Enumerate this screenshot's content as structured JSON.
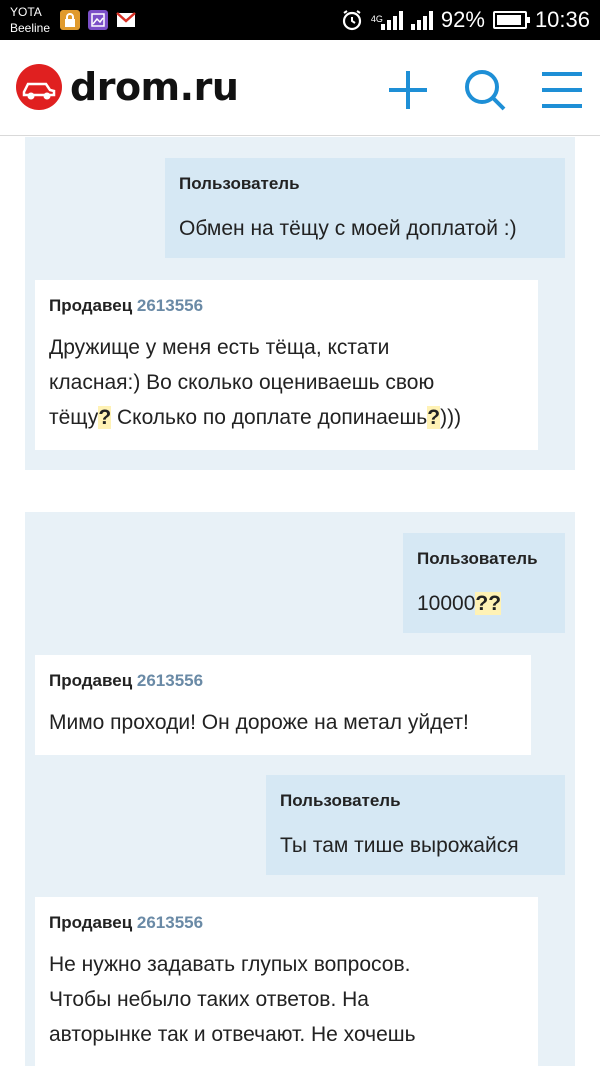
{
  "status_bar": {
    "carrier_1": "YOTA",
    "carrier_2": "Beeline",
    "network": "4G",
    "battery": "92%",
    "battery_level": 0.92,
    "time": "10:36"
  },
  "header": {
    "logo_text": "drom.ru",
    "icons": [
      "plus-icon",
      "search-icon",
      "menu-icon"
    ]
  },
  "conversation_1": {
    "user_author": "Пользователь",
    "user_message": "Обмен на тёщу с моей доплатой :)",
    "seller_author": "Продавец",
    "seller_id": "2613556",
    "seller_line_1": "Дружище у меня есть тёща, кстати",
    "seller_line_2": "класная:) Во сколько оцениваешь свою",
    "seller_line_3a": "тёщу",
    "seller_line_3q1": "?",
    "seller_line_3b": " Сколько по доплате допинаешь",
    "seller_line_3q2": "?",
    "seller_line_3c": ")))"
  },
  "conversation_2": {
    "user1_author": "Пользователь",
    "user1_message_a": "10000",
    "user1_message_q": "??",
    "seller1_author": "Продавец",
    "seller1_id": "2613556",
    "seller1_message": "Мимо проходи! Он дороже на метал уйдет!",
    "user2_author": "Пользователь",
    "user2_message": "Ты там тише вырожайся",
    "seller2_author": "Продавец",
    "seller2_id": "2613556",
    "seller2_line_1": "Не нужно задавать глупых вопросов.",
    "seller2_line_2": "Чтобы небыло таких ответов. На",
    "seller2_line_3": "авторынке так и отвечают. Не хочешь"
  },
  "colors": {
    "brand_red": "#e02020",
    "accent_blue": "#1e8fd6",
    "card_bg": "#e8f1f7",
    "user_bubble": "#d6e8f4",
    "highlight": "#fff2b5"
  }
}
